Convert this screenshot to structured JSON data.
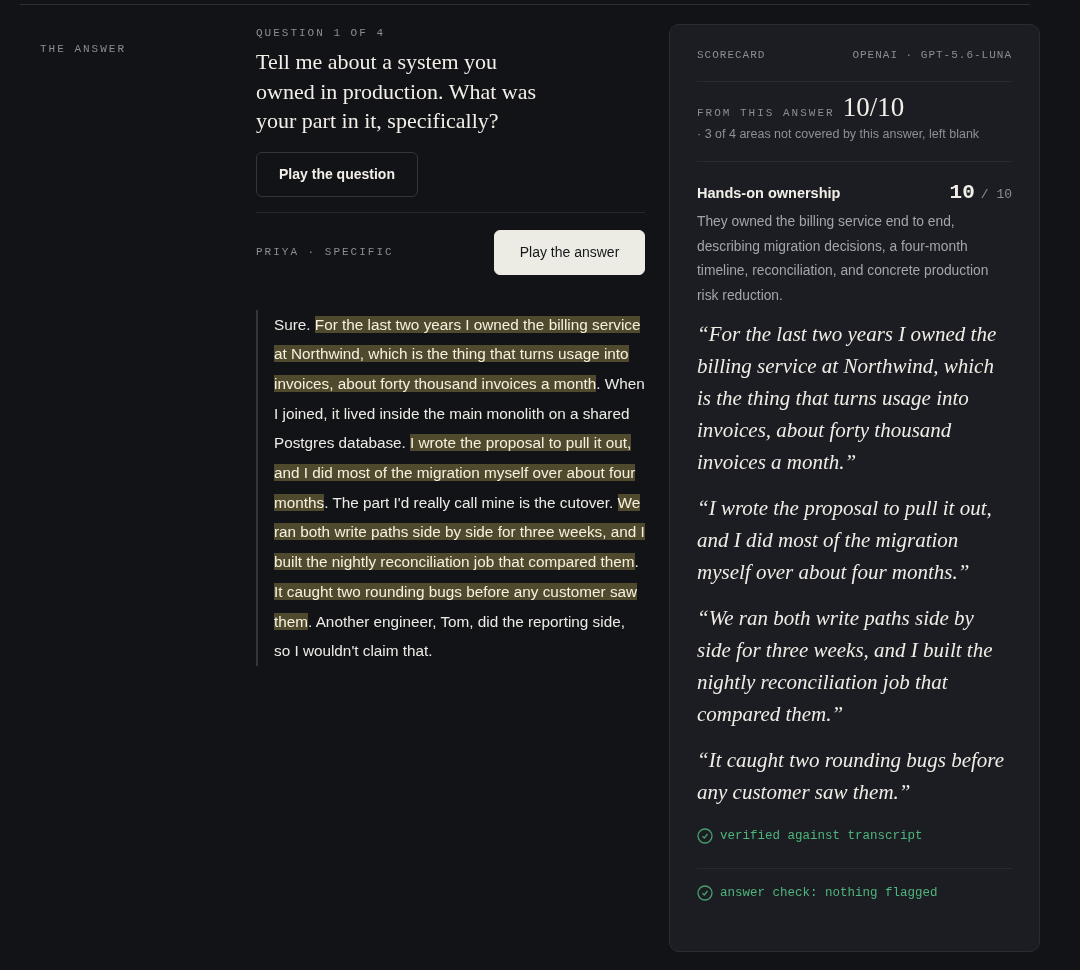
{
  "section_label": "THE ANSWER",
  "question": {
    "counter": "QUESTION 1 OF 4",
    "text": "Tell me about a system you owned in production. What was your part in it, specifically?",
    "play_button": "Play the question"
  },
  "answer": {
    "speaker": "PRIYA · SPECIFIC",
    "play_button": "Play the answer",
    "segments": [
      {
        "text": "Sure. ",
        "highlighted": false
      },
      {
        "text": "For the last two years I owned the billing service at Northwind, which is the thing that turns usage into invoices, about forty thousand invoices a month",
        "highlighted": true
      },
      {
        "text": ". When I joined, it lived inside the main monolith on a shared Postgres database. ",
        "highlighted": false
      },
      {
        "text": "I wrote the proposal to pull it out, and I did most of the migration myself over about four months",
        "highlighted": true
      },
      {
        "text": ". The part I'd really call mine is the cutover. ",
        "highlighted": false
      },
      {
        "text": "We ran both write paths side by side for three weeks, and I built the nightly reconciliation job that compared them",
        "highlighted": true
      },
      {
        "text": ". ",
        "highlighted": false
      },
      {
        "text": "It caught two rounding bugs before any customer saw them",
        "highlighted": true
      },
      {
        "text": ". Another engineer, Tom, did the reporting side, so I wouldn't claim that.",
        "highlighted": false
      }
    ]
  },
  "scorecard": {
    "title": "SCORECARD",
    "model": "OPENAI · GPT-5.6-LUNA",
    "from_label": "FROM THIS ANSWER",
    "total": "10/10",
    "note": "· 3 of 4 areas not covered by this answer, left blank",
    "criterion": {
      "name": "Hands-on ownership",
      "score": "10",
      "out_of": "/ 10",
      "summary": "They owned the billing service end to end, describing migration decisions, a four-month timeline, reconciliation, and concrete production risk reduction."
    },
    "quotes": [
      "“For the last two years I owned the billing service at Northwind, which is the thing that turns usage into invoices, about forty thousand invoices a month.”",
      "“I wrote the proposal to pull it out, and I did most of the migration myself over about four months.”",
      "“We ran both write paths side by side for three weeks, and I built the nightly reconciliation job that compared them.”",
      "“It caught two rounding bugs before any customer saw them.”"
    ],
    "checks": [
      "verified against transcript",
      "answer check: nothing flagged"
    ]
  }
}
